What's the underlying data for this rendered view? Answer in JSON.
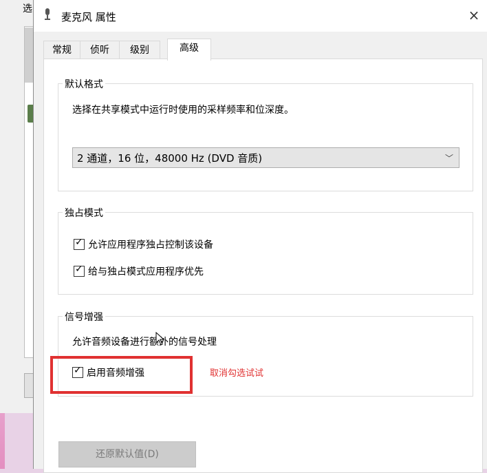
{
  "background_window": {
    "title_fragment": "选"
  },
  "dialog": {
    "title": "麦克风 属性",
    "close_glyph": "×",
    "tabs": [
      {
        "label": "常规"
      },
      {
        "label": "侦听"
      },
      {
        "label": "级别"
      },
      {
        "label": "高级",
        "active": true
      }
    ],
    "default_format": {
      "title": "默认格式",
      "description": "选择在共享模式中运行时使用的采样频率和位深度。",
      "selected_value": "2 通道，16 位，48000 Hz (DVD 音质)",
      "chevron": "﹀"
    },
    "exclusive_mode": {
      "title": "独占模式",
      "options": [
        {
          "label": "允许应用程序独占控制该设备",
          "checked": true
        },
        {
          "label": "给与独占模式应用程序优先",
          "checked": true
        }
      ]
    },
    "signal_enhancement": {
      "title": "信号增强",
      "description": "允许音频设备进行额外的信号处理",
      "option": {
        "label": "启用音频增强",
        "checked": true
      }
    },
    "annotation": "取消勾选试试",
    "restore_button": "还原默认值(D)"
  },
  "colors": {
    "annotation_red": "#e03131",
    "dialog_bg": "#f0f0f0",
    "panel_bg": "#ffffff"
  }
}
